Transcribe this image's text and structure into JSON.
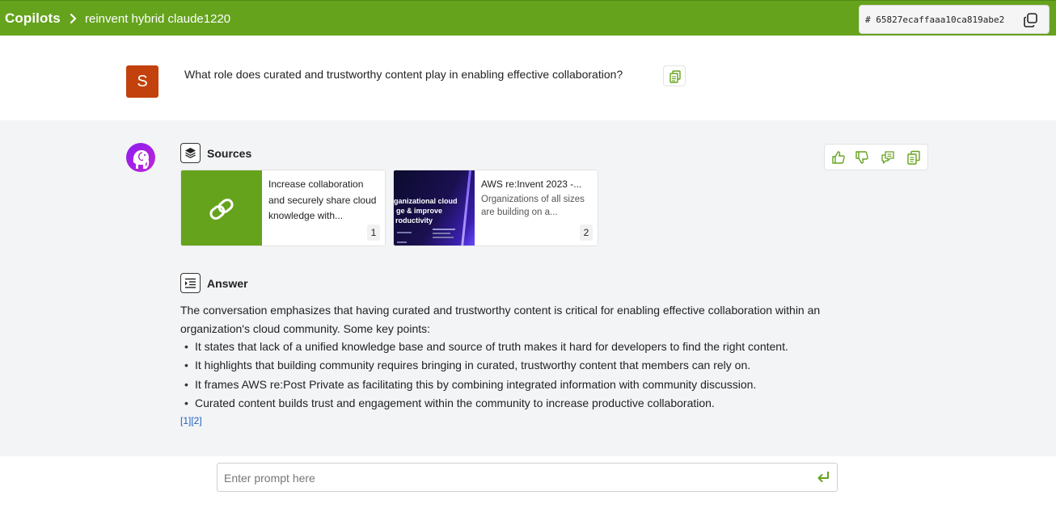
{
  "header": {
    "brand": "Copilots",
    "breadcrumb": "reinvent hybrid claude1220",
    "session_id": "# 65827ecaffaaa10ca819abe2",
    "accent": "#65a31d"
  },
  "user": {
    "avatar_letter": "S",
    "avatar_color": "#c2410c",
    "question": "What role does curated and trustworthy content play in enabling effective collaboration?"
  },
  "sources": {
    "title": "Sources",
    "cards": [
      {
        "title": "Increase collaboration and securely share cloud knowledge with...",
        "number": "1",
        "thumb": "link-icon"
      },
      {
        "title": "AWS re:Invent 2023 -...",
        "description": "Organizations of all sizes are building on a...",
        "number": "2",
        "thumb": "presentation-slide",
        "thumb_lines": [
          "ganizational cloud",
          "ge & improve",
          "roductivity"
        ]
      }
    ]
  },
  "answer": {
    "title": "Answer",
    "intro": "The conversation emphasizes that having curated and trustworthy content is critical for enabling effective collaboration within an organization's cloud community. Some key points:",
    "bullets": [
      "It states that lack of a unified knowledge base and source of truth makes it hard for developers to find the right content.",
      "It highlights that building community requires bringing in curated, trustworthy content that members can rely on.",
      "It frames AWS re:Post Private as facilitating this by combining integrated information with community discussion.",
      "Curated content builds trust and engagement within the community to increase productive collaboration."
    ],
    "citations": [
      "[1]",
      "[2]"
    ]
  },
  "feedback": {
    "icons": [
      "thumbs-up-icon",
      "thumbs-down-icon",
      "comment-icon",
      "copy-icon"
    ]
  },
  "prompt": {
    "placeholder": "Enter prompt here",
    "value": ""
  }
}
